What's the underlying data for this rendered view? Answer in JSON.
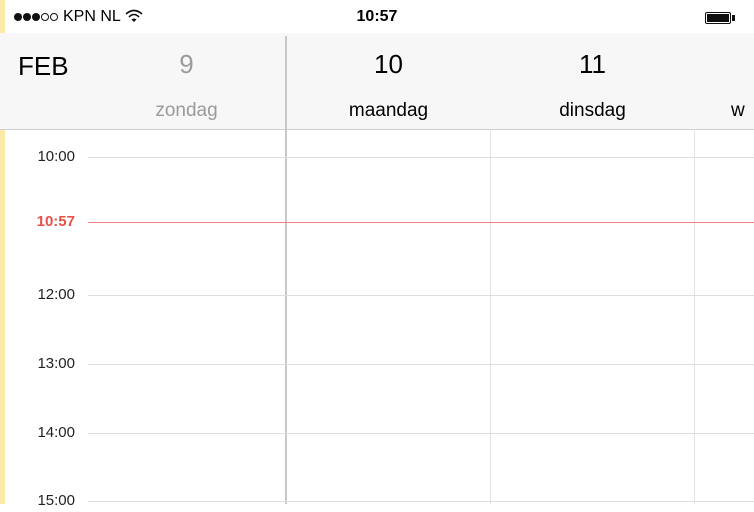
{
  "status_bar": {
    "signal": [
      "filled",
      "filled",
      "filled",
      "empty",
      "empty"
    ],
    "carrier": "KPN NL",
    "wifi_icon": "wifi-icon",
    "time": "10:57",
    "battery_icon": "battery-icon"
  },
  "header": {
    "month": "FEB",
    "days": [
      {
        "number": "9",
        "name": "zondag"
      },
      {
        "number": "10",
        "name": "maandag"
      },
      {
        "number": "11",
        "name": "dinsdag"
      },
      {
        "number": "",
        "name": "w"
      }
    ]
  },
  "timeline": {
    "hours": [
      "10:00",
      "12:00",
      "13:00",
      "14:00",
      "15:00"
    ],
    "current_time": "10:57"
  },
  "colors": {
    "current_time": "#e8514a",
    "header_bg": "#f7f7f7",
    "edge_strip": "#fbe9a6"
  }
}
